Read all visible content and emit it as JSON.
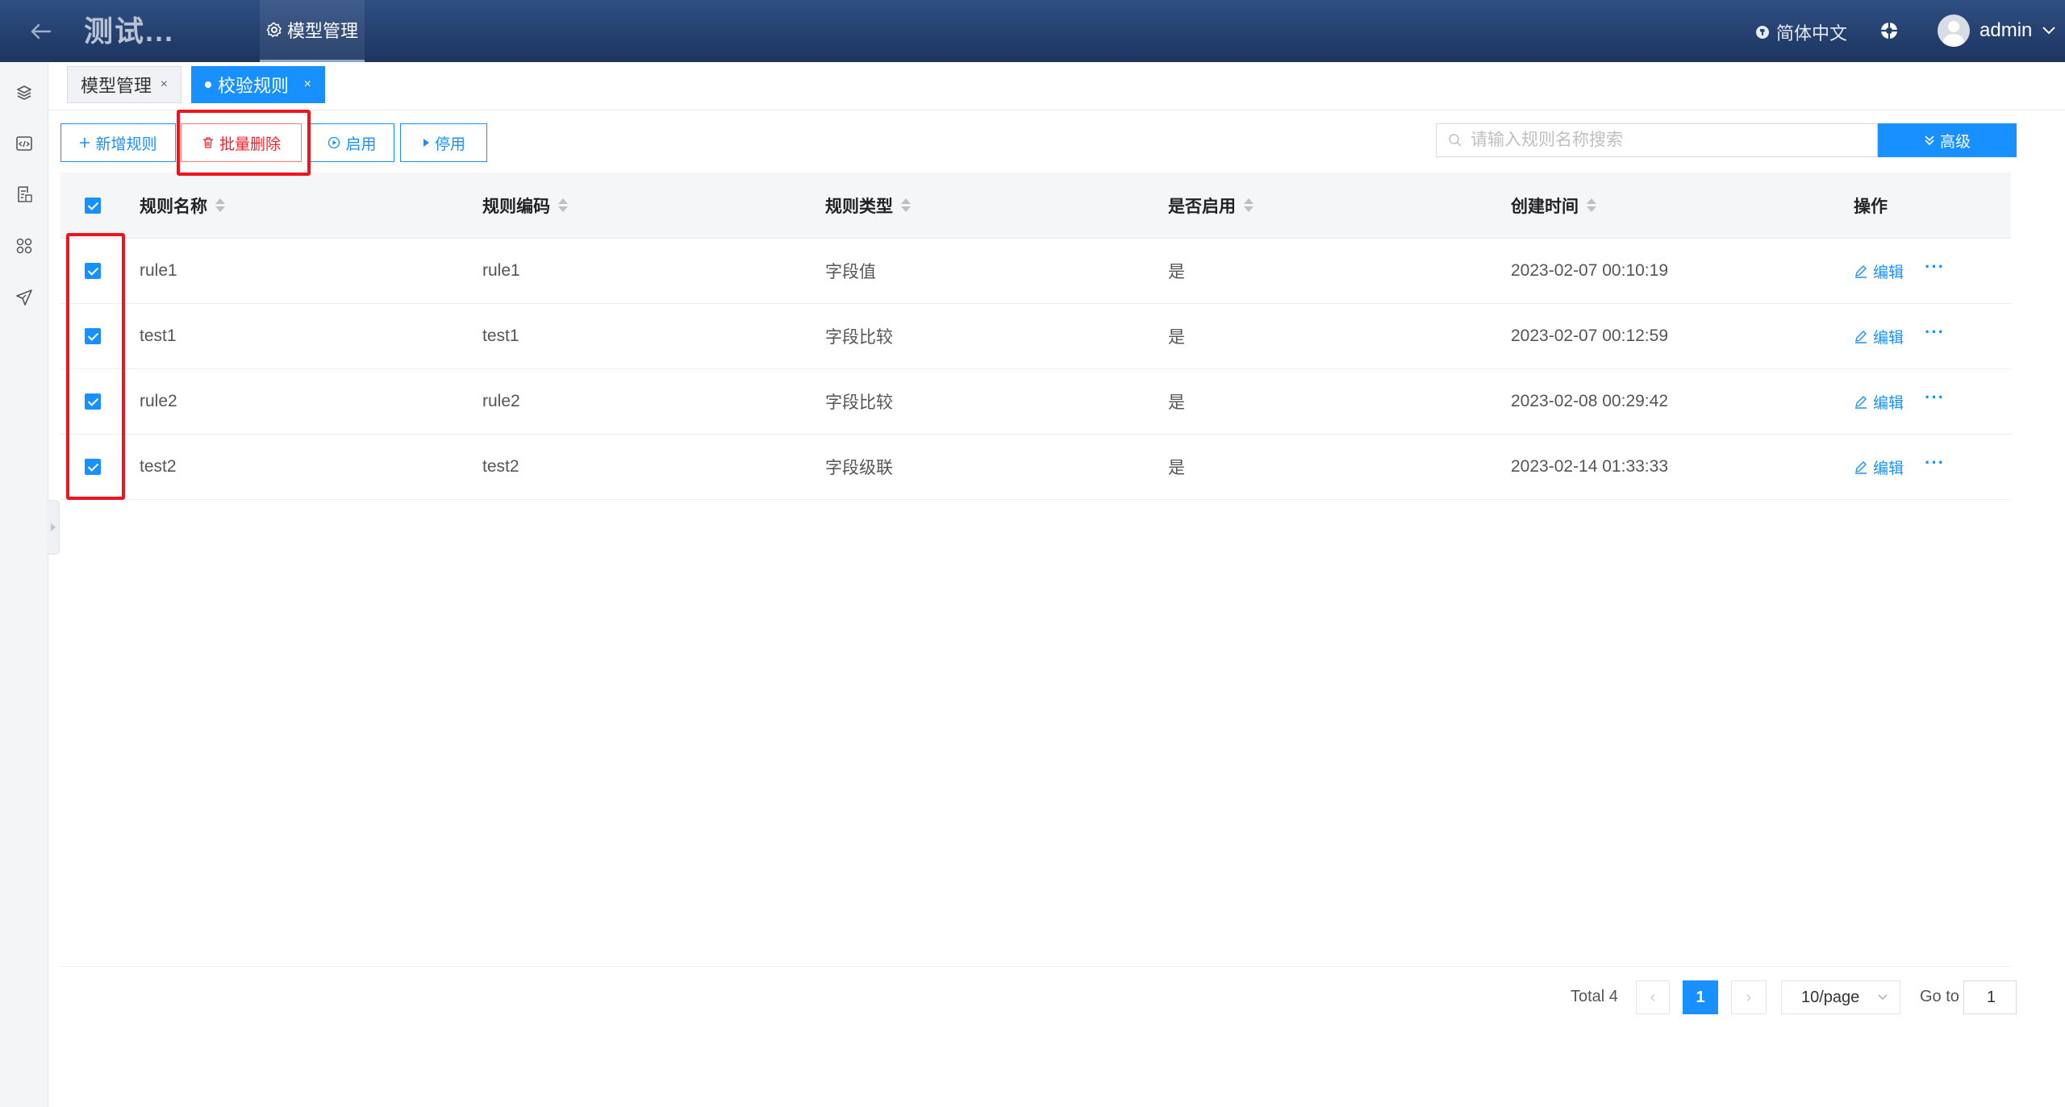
{
  "header": {
    "app_title": "测试...",
    "nav_tab": "模型管理",
    "language": "简体中文",
    "username": "admin"
  },
  "tabs": [
    {
      "label": "模型管理",
      "close": "×"
    },
    {
      "label": "校验规则",
      "close": "×"
    }
  ],
  "toolbar": {
    "add": "新增规则",
    "batch_delete": "批量删除",
    "enable": "启用",
    "disable": "停用",
    "search_placeholder": "请输入规则名称搜索",
    "advanced": "高级"
  },
  "table": {
    "columns": [
      "规则名称",
      "规则编码",
      "规则类型",
      "是否启用",
      "创建时间",
      "操作"
    ],
    "rows": [
      {
        "name": "rule1",
        "code": "rule1",
        "type": "字段值",
        "enabled": "是",
        "created": "2023-02-07 00:10:19",
        "edit": "编辑",
        "more": "···"
      },
      {
        "name": "test1",
        "code": "test1",
        "type": "字段比较",
        "enabled": "是",
        "created": "2023-02-07 00:12:59",
        "edit": "编辑",
        "more": "···"
      },
      {
        "name": "rule2",
        "code": "rule2",
        "type": "字段比较",
        "enabled": "是",
        "created": "2023-02-08 00:29:42",
        "edit": "编辑",
        "more": "···"
      },
      {
        "name": "test2",
        "code": "test2",
        "type": "字段级联",
        "enabled": "是",
        "created": "2023-02-14 01:33:33",
        "edit": "编辑",
        "more": "···"
      }
    ]
  },
  "pagination": {
    "total": "Total 4",
    "page_prev": "‹",
    "current_page": "1",
    "page_next": "›",
    "page_size": "10/page",
    "goto_label": "Go to",
    "goto_value": "1"
  },
  "colors": {
    "primary": "#1890ff",
    "header_bg": "#24406e",
    "danger": "#f5222d",
    "highlight": "#f0141e"
  }
}
